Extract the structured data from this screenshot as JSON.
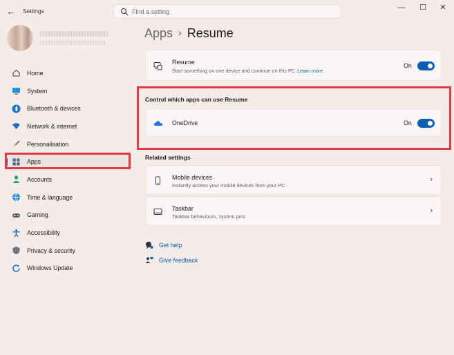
{
  "window": {
    "title": "Settings",
    "back_glyph": "←",
    "minimize_glyph": "—",
    "maximize_glyph": "☐",
    "close_glyph": "✕"
  },
  "search": {
    "placeholder": "Find a setting",
    "icon": "search-icon"
  },
  "sidebar": {
    "selected": "Apps",
    "items": [
      {
        "label": "Home",
        "icon": "home-icon"
      },
      {
        "label": "System",
        "icon": "system-icon"
      },
      {
        "label": "Bluetooth & devices",
        "icon": "bluetooth-icon"
      },
      {
        "label": "Network & internet",
        "icon": "wifi-icon"
      },
      {
        "label": "Personalisation",
        "icon": "brush-icon"
      },
      {
        "label": "Apps",
        "icon": "apps-icon"
      },
      {
        "label": "Accounts",
        "icon": "person-icon"
      },
      {
        "label": "Time & language",
        "icon": "globe-icon"
      },
      {
        "label": "Gaming",
        "icon": "gamepad-icon"
      },
      {
        "label": "Accessibility",
        "icon": "accessibility-icon"
      },
      {
        "label": "Privacy & security",
        "icon": "shield-icon"
      },
      {
        "label": "Windows Update",
        "icon": "update-icon"
      }
    ]
  },
  "breadcrumb": {
    "root": "Apps",
    "separator": "›",
    "page": "Resume"
  },
  "resume_card": {
    "title": "Resume",
    "description": "Start something on one device and continue on this PC",
    "link": "Learn more",
    "toggle_state": "On",
    "icon": "resume-icon"
  },
  "control_section": {
    "heading": "Control which apps can use Resume",
    "apps": [
      {
        "name": "OneDrive",
        "toggle_state": "On",
        "icon": "onedrive-cloud-icon"
      }
    ]
  },
  "related": {
    "heading": "Related settings",
    "items": [
      {
        "title": "Mobile devices",
        "description": "Instantly access your mobile devices from your PC",
        "icon": "phone-icon"
      },
      {
        "title": "Taskbar",
        "description": "Taskbar behaviours, system pins",
        "icon": "taskbar-icon"
      }
    ],
    "chevron_glyph": "›"
  },
  "footer_links": [
    {
      "label": "Get help",
      "icon": "help-icon"
    },
    {
      "label": "Give feedback",
      "icon": "feedback-icon"
    }
  ],
  "colors": {
    "accent": "#0a5fb4",
    "highlight": "#e23a43",
    "background": "#f5ebe8"
  }
}
